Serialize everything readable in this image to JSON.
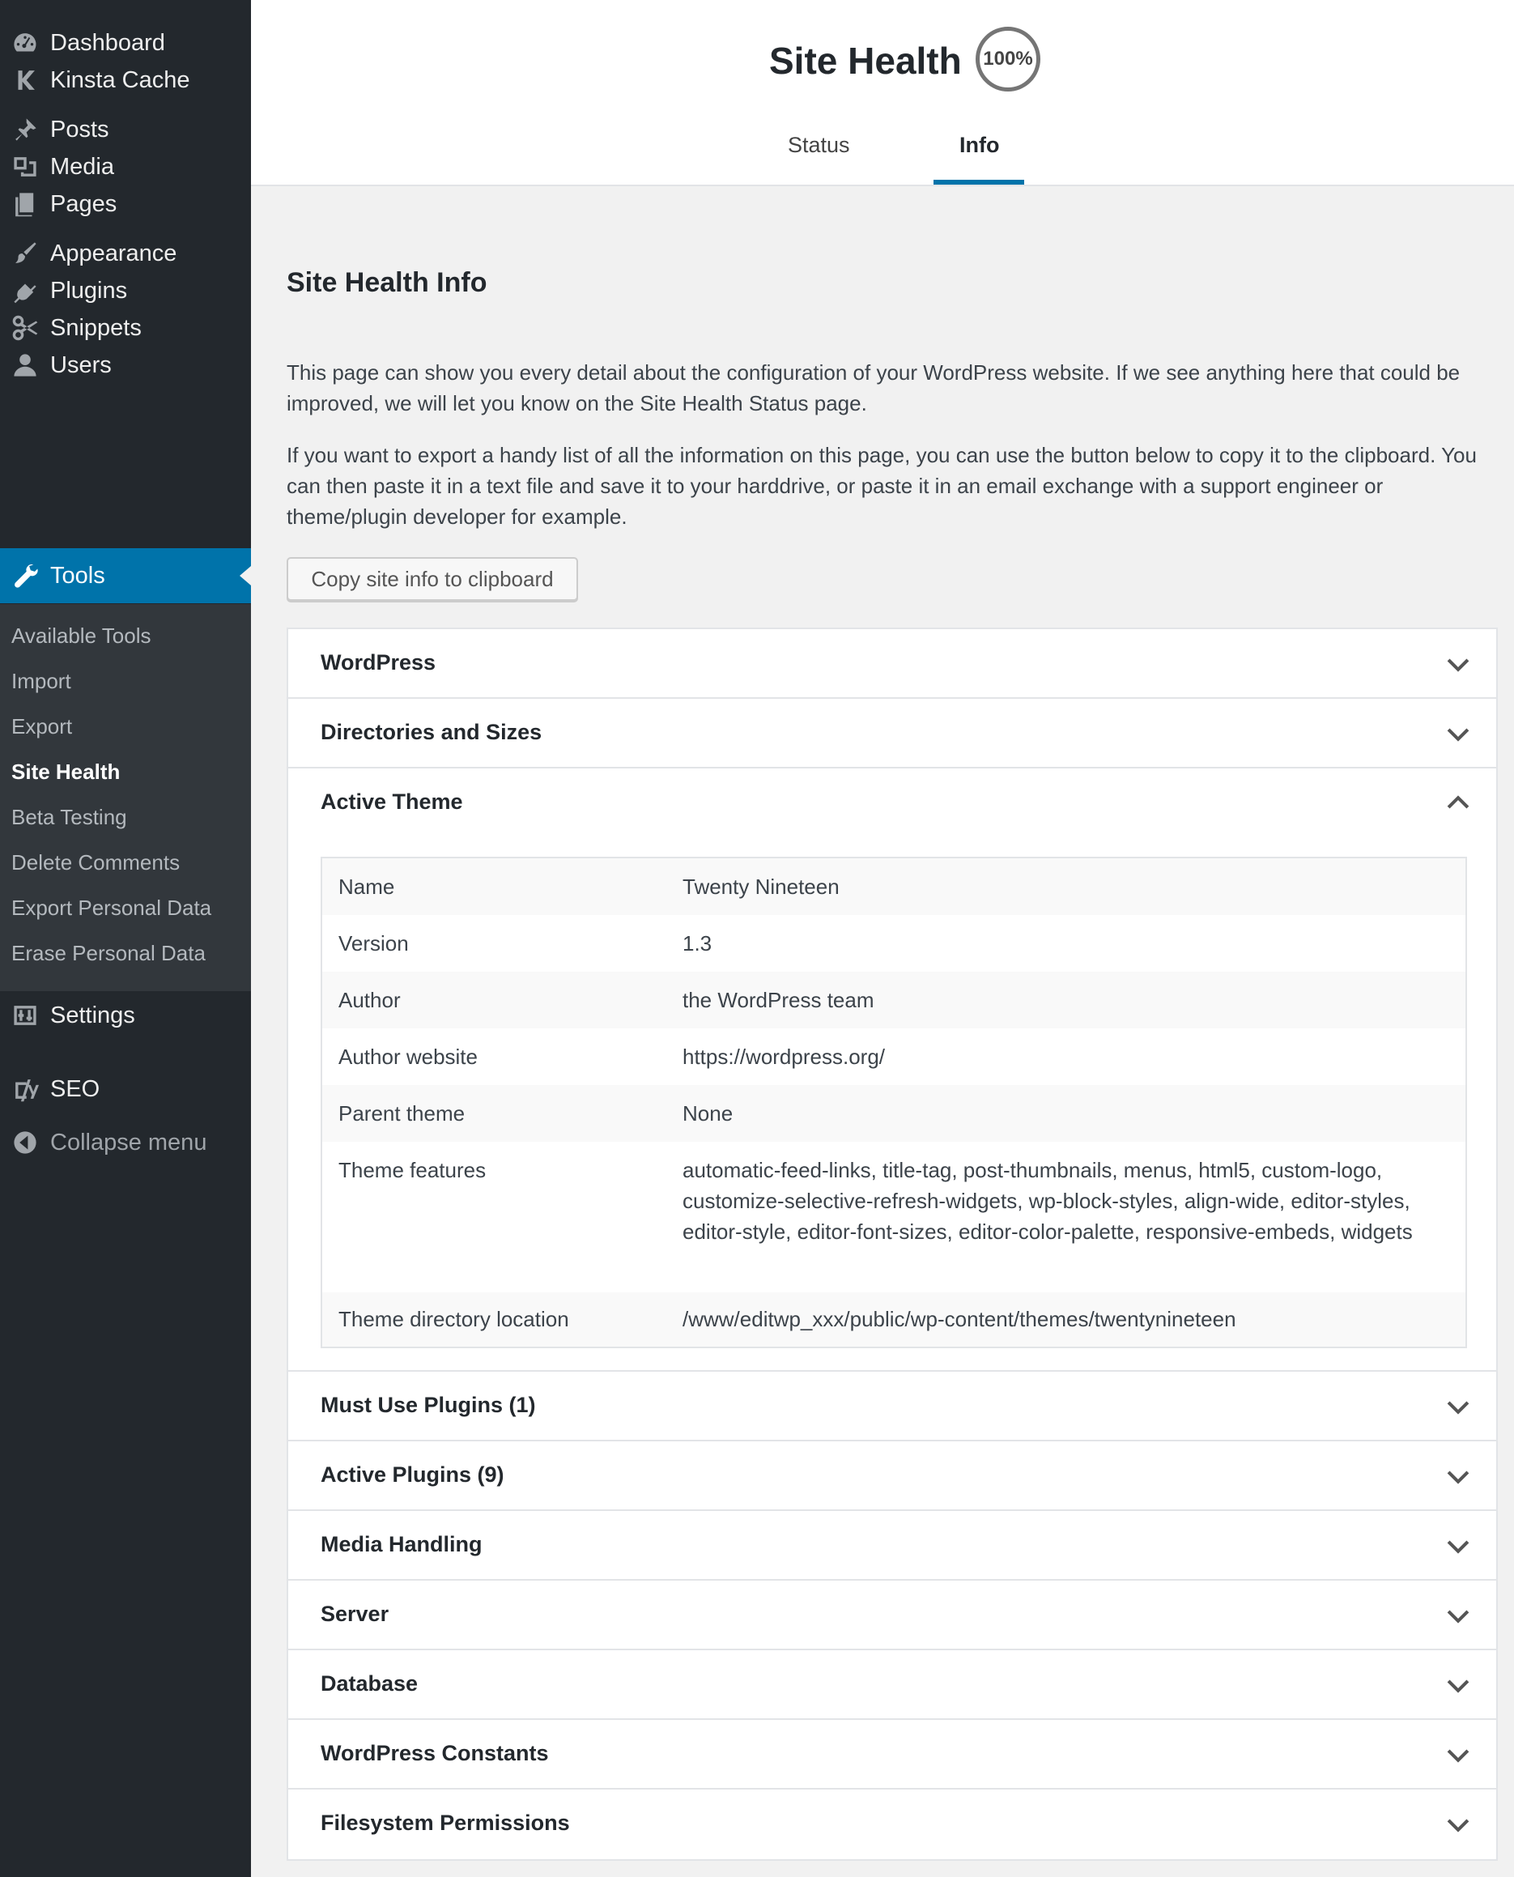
{
  "sidebar": {
    "items": [
      {
        "label": "Dashboard",
        "icon": "dashboard-icon"
      },
      {
        "label": "Kinsta Cache",
        "icon": "kinsta-icon"
      },
      {
        "label": "Posts",
        "icon": "pin-icon"
      },
      {
        "label": "Media",
        "icon": "media-icon"
      },
      {
        "label": "Pages",
        "icon": "pages-icon"
      },
      {
        "label": "Appearance",
        "icon": "brush-icon"
      },
      {
        "label": "Plugins",
        "icon": "plug-icon"
      },
      {
        "label": "Snippets",
        "icon": "scissors-icon"
      },
      {
        "label": "Users",
        "icon": "user-icon"
      },
      {
        "label": "Tools",
        "icon": "wrench-icon"
      },
      {
        "label": "Settings",
        "icon": "sliders-icon"
      },
      {
        "label": "SEO",
        "icon": "yoast-icon"
      },
      {
        "label": "Collapse menu",
        "icon": "collapse-arrow-icon"
      }
    ],
    "submenu": [
      {
        "label": "Available Tools"
      },
      {
        "label": "Import"
      },
      {
        "label": "Export"
      },
      {
        "label": "Site Health"
      },
      {
        "label": "Beta Testing"
      },
      {
        "label": "Delete Comments"
      },
      {
        "label": "Export Personal Data"
      },
      {
        "label": "Erase Personal Data"
      }
    ]
  },
  "header": {
    "title": "Site Health",
    "score": "100%",
    "tabs": [
      {
        "label": "Status"
      },
      {
        "label": "Info"
      }
    ]
  },
  "main": {
    "heading": "Site Health Info",
    "paragraph1": "This page can show you every detail about the configuration of your WordPress website. If we see anything here that could be improved, we will let you know on the Site Health Status page.",
    "paragraph2": "If you want to export a handy list of all the information on this page, you can use the button below to copy it to the clipboard. You can then paste it in a text file and save it to your harddrive, or paste it in an email exchange with a support engineer or theme/plugin developer for example.",
    "copy_button": "Copy site info to clipboard",
    "sections": [
      {
        "label": "WordPress"
      },
      {
        "label": "Directories and Sizes"
      },
      {
        "label": "Active Theme"
      },
      {
        "label": "Must Use Plugins (1)"
      },
      {
        "label": "Active Plugins (9)"
      },
      {
        "label": "Media Handling"
      },
      {
        "label": "Server"
      },
      {
        "label": "Database"
      },
      {
        "label": "WordPress Constants"
      },
      {
        "label": "Filesystem Permissions"
      }
    ],
    "active_theme": [
      {
        "key": "Name",
        "value": "Twenty Nineteen"
      },
      {
        "key": "Version",
        "value": "1.3"
      },
      {
        "key": "Author",
        "value": "the WordPress team"
      },
      {
        "key": "Author website",
        "value": "https://wordpress.org/"
      },
      {
        "key": "Parent theme",
        "value": "None"
      },
      {
        "key": "Theme features",
        "value": "automatic-feed-links, title-tag, post-thumbnails, menus, html5, custom-logo, customize-selective-refresh-widgets, wp-block-styles, align-wide, editor-styles, editor-style, editor-font-sizes, editor-color-palette, responsive-embeds, widgets"
      },
      {
        "key": "Theme directory location",
        "value": "/www/editwp_xxx/public/wp-content/themes/twentynineteen"
      }
    ]
  },
  "colors": {
    "sidebar_bg": "#23282d",
    "submenu_bg": "#32373c",
    "accent": "#0073aa"
  }
}
